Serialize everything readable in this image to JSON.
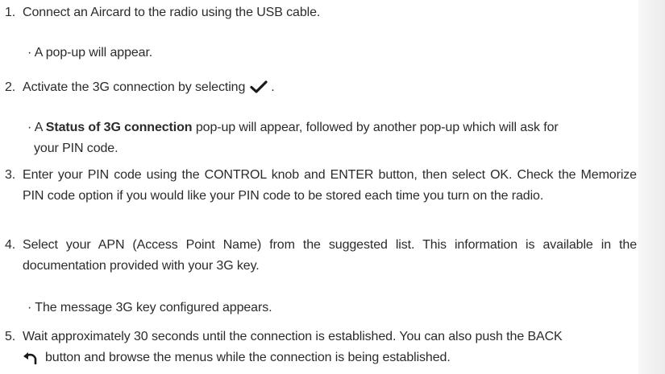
{
  "steps": [
    {
      "number": "1.",
      "text": "Connect an Aircard to the radio using the USB cable.",
      "note": "A pop-up will appear."
    },
    {
      "number": "2.",
      "text_before_icon": "Activate the 3G connection by selecting",
      "text_after_icon": ".",
      "icon": "checkmark-icon",
      "note_prefix": "A",
      "note_bold": "Status of 3G connection",
      "note_rest_line1": "pop-up will appear, followed by another pop-up which will ask for",
      "note_rest_line2": "your PIN code."
    },
    {
      "number": "3.",
      "text": "Enter your PIN code using the CONTROL knob and ENTER button, then select OK. Check the Memorize PIN code option if you would like your PIN code to be stored each time you turn on the radio."
    },
    {
      "number": "4.",
      "text": "Select your APN (Access Point Name) from the suggested list. This information is available in the documentation provided with your 3G key.",
      "note": "The message 3G key configured appears."
    },
    {
      "number": "5.",
      "text_line1": "Wait approximately 30 seconds until the connection is established. You can also push the BACK",
      "icon": "back-arrow-icon",
      "text_line2": "button and browse the menus while the connection is being established."
    }
  ],
  "bullet_symbol": "·",
  "colors": {
    "text": "#2b2b2b",
    "background": "#ffffff",
    "side_band": "#ececec"
  }
}
